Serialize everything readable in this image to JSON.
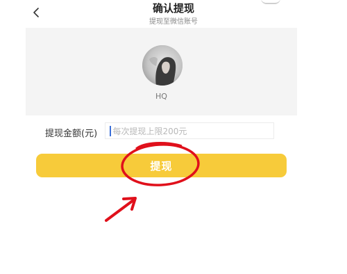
{
  "header": {
    "back_icon": "chevron-left-icon",
    "title": "确认提现",
    "subtitle": "提现至微信账号"
  },
  "profile": {
    "name": "HQ"
  },
  "amount": {
    "label": "提现金额(元)",
    "placeholder": "每次提现上限200元",
    "value": ""
  },
  "action": {
    "withdraw_label": "提现",
    "button_color": "#f7cb3a"
  },
  "annotation": {
    "color": "#e0101b",
    "shapes": [
      "circle",
      "arrow"
    ]
  }
}
